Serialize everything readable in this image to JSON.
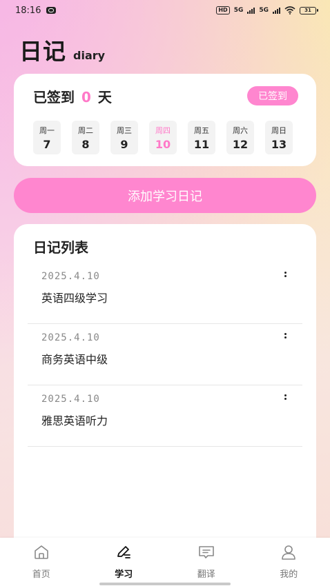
{
  "status_bar": {
    "time": "18:16",
    "hd_badge": "HD",
    "signal1": "5G",
    "signal2": "5G",
    "battery": "31"
  },
  "header": {
    "title": "日记",
    "subtitle": "diary"
  },
  "signin": {
    "prefix": "已签到",
    "count": "0",
    "suffix": "天",
    "status_button": "已签到",
    "days": [
      {
        "name": "周一",
        "num": "7"
      },
      {
        "name": "周二",
        "num": "8"
      },
      {
        "name": "周三",
        "num": "9"
      },
      {
        "name": "周四",
        "num": "10"
      },
      {
        "name": "周五",
        "num": "11"
      },
      {
        "name": "周六",
        "num": "12"
      },
      {
        "name": "周日",
        "num": "13"
      }
    ],
    "active_day": "周四"
  },
  "add_button": "添加学习日记",
  "diary_list": {
    "title": "日记列表",
    "entries": [
      {
        "date": "2025.4.10",
        "title": "英语四级学习"
      },
      {
        "date": "2025.4.10",
        "title": "商务英语中级"
      },
      {
        "date": "2025.4.10",
        "title": "雅思英语听力"
      }
    ]
  },
  "tabbar": {
    "items": [
      {
        "label": "首页",
        "icon": "home-icon"
      },
      {
        "label": "学习",
        "icon": "pen-icon"
      },
      {
        "label": "翻译",
        "icon": "chat-icon"
      },
      {
        "label": "我的",
        "icon": "user-icon"
      }
    ],
    "active": "学习"
  },
  "colors": {
    "accent": "#ff86cf",
    "accent_text": "#ff79c8"
  }
}
